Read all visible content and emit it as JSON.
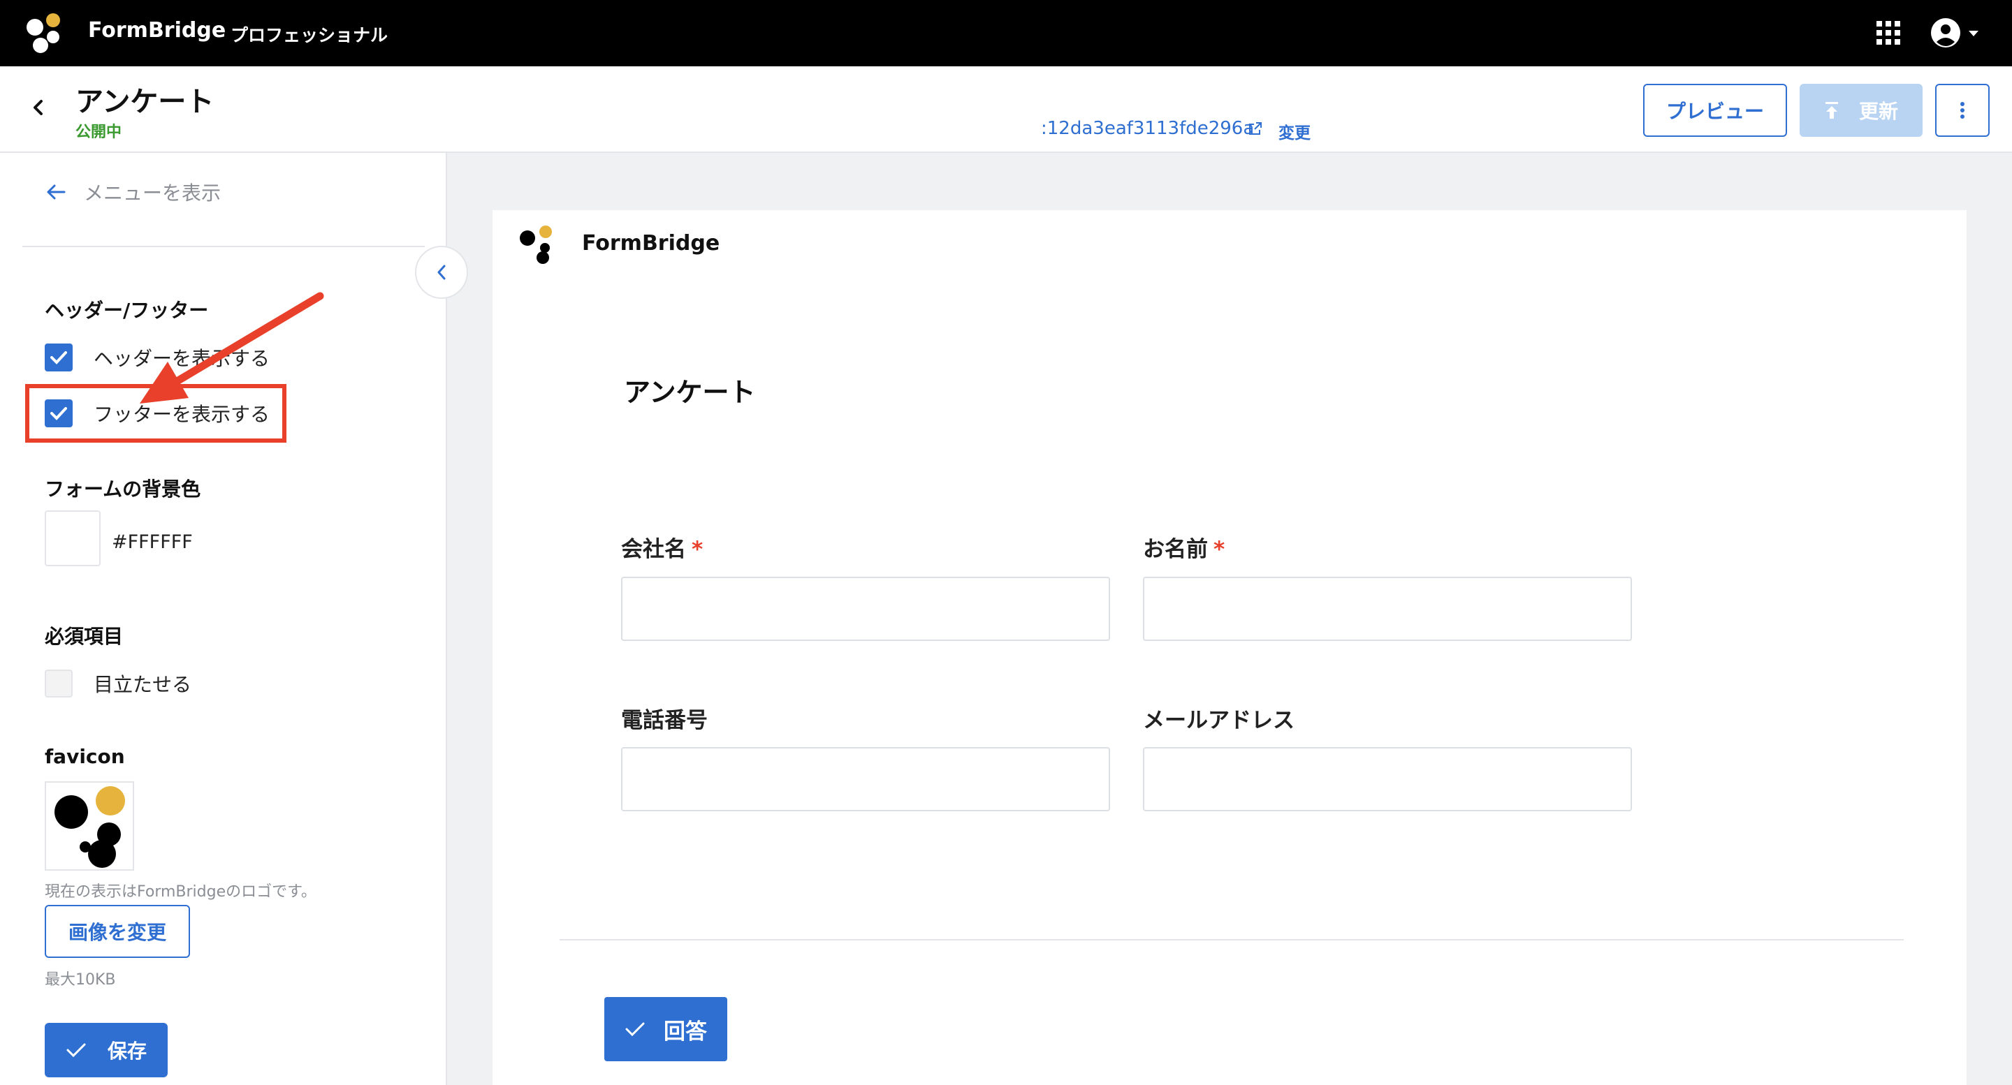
{
  "app": {
    "brand": "FormBridge",
    "plan": "プロフェッショナル",
    "accent_color": "#2f6fd1",
    "topbar_color": "#000000"
  },
  "header": {
    "title": "アンケート",
    "status": "公開中",
    "form_id": ":12da3eaf3113fde296a",
    "change_label": "変更",
    "preview_label": "プレビュー",
    "update_label": "更新"
  },
  "sidebar": {
    "menu_toggle_label": "メニューを表示",
    "header_footer": {
      "title": "ヘッダー/フッター",
      "show_header_label": "ヘッダーを表示する",
      "show_header_checked": true,
      "show_footer_label": "フッターを表示する",
      "show_footer_checked": true
    },
    "background": {
      "title": "フォームの背景色",
      "value": "#FFFFFF"
    },
    "required": {
      "title": "必須項目",
      "highlight_label": "目立たせる",
      "highlight_checked": false
    },
    "favicon": {
      "title": "favicon",
      "note": "現在の表示はFormBridgeのロゴです。",
      "change_button": "画像を変更",
      "max_size": "最大10KB"
    },
    "save_label": "保存"
  },
  "preview": {
    "brand": "FormBridge",
    "title": "アンケート",
    "fields": [
      {
        "label": "会社名",
        "required": "*"
      },
      {
        "label": "お名前",
        "required": "*"
      },
      {
        "label": "電話番号",
        "required": ""
      },
      {
        "label": "メールアドレス",
        "required": ""
      }
    ],
    "submit_label": "回答"
  },
  "annotation": {
    "color": "#e8402a"
  }
}
